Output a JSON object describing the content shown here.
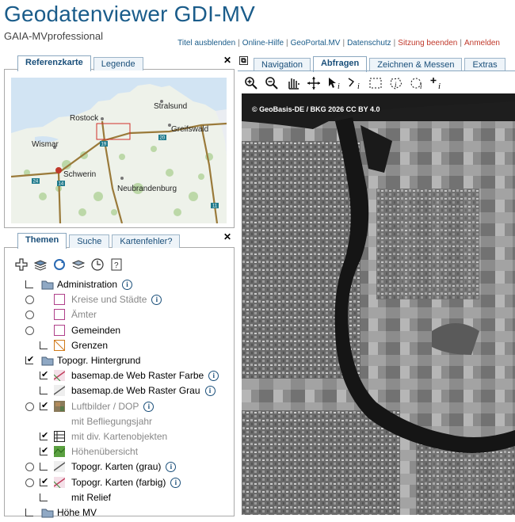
{
  "header": {
    "title": "Geodatenviewer GDI-MV",
    "subtitle": "GAIA-MVprofessional",
    "links": [
      {
        "label": "Titel ausblenden",
        "color": "#1a5c8a"
      },
      {
        "label": "Online-Hilfe",
        "color": "#1a5c8a"
      },
      {
        "label": "GeoPortal.MV",
        "color": "#1a5c8a"
      },
      {
        "label": "Datenschutz",
        "color": "#1a5c8a"
      },
      {
        "label": "Sitzung beenden",
        "color": "#c0392b"
      },
      {
        "label": "Anmelden",
        "color": "#c0392b"
      }
    ]
  },
  "ref_panel": {
    "tabs": [
      "Referenzkarte",
      "Legende"
    ],
    "active": 0,
    "places": [
      "Stralsund",
      "Rostock",
      "Greifswald",
      "Wismar",
      "Schwerin",
      "Neubrandenburg"
    ],
    "roads": [
      "19",
      "20",
      "24",
      "14",
      "11"
    ]
  },
  "layers_panel": {
    "tabs": [
      "Themen",
      "Suche",
      "Kartenfehler?"
    ],
    "active": 0,
    "layers": [
      {
        "label": "Administration",
        "control": "collapse",
        "icon": "folder",
        "info": true,
        "gray": false
      },
      {
        "label": "Kreise und Städte",
        "control": "radio",
        "icon": "swatch-purple",
        "info": true,
        "gray": true
      },
      {
        "label": "Ämter",
        "control": "radio",
        "icon": "swatch-purple",
        "info": false,
        "gray": true
      },
      {
        "label": "Gemeinden",
        "control": "radio",
        "icon": "swatch-purple",
        "info": false,
        "gray": false
      },
      {
        "label": "Grenzen",
        "control": "collapse",
        "icon": "swatch-orange",
        "info": false,
        "gray": false
      },
      {
        "label": "Topogr. Hintergrund",
        "control": "checked",
        "icon": "folder",
        "info": false,
        "gray": false
      },
      {
        "label": "basemap.de Web Raster Farbe",
        "control": "checked",
        "icon": "line-color",
        "info": true,
        "gray": false
      },
      {
        "label": "basemap.de Web Raster Grau",
        "control": "collapse",
        "icon": "line-gray",
        "info": true,
        "gray": false
      },
      {
        "label": "Luftbilder / DOP",
        "control": "radio-checked",
        "icon": "photo",
        "info": true,
        "gray": true
      },
      {
        "label": "mit Befliegungsjahr",
        "control": "none",
        "icon": "none",
        "info": false,
        "gray": true
      },
      {
        "label": "mit div. Kartenobjekten",
        "control": "checked-small",
        "icon": "table",
        "info": false,
        "gray": true
      },
      {
        "label": "Höhenübersicht",
        "control": "checked-small",
        "icon": "green",
        "info": false,
        "gray": true
      },
      {
        "label": "Topogr. Karten (grau)",
        "control": "radio-collapse",
        "icon": "line-gray",
        "info": true,
        "gray": false
      },
      {
        "label": "Topogr. Karten (farbig)",
        "control": "radio-checked",
        "icon": "line-color",
        "info": true,
        "gray": false
      },
      {
        "label": "mit Relief",
        "control": "collapse",
        "icon": "none",
        "info": false,
        "gray": false
      },
      {
        "label": "Höhe MV",
        "control": "collapse",
        "icon": "folder",
        "info": false,
        "gray": false
      }
    ]
  },
  "map_panel": {
    "tabs": [
      "Navigation",
      "Abfragen",
      "Zeichnen & Messen",
      "Extras"
    ],
    "active": 1,
    "tools": [
      "zoom-in-icon",
      "zoom-out-icon",
      "pan-hand-icon",
      "move-icon",
      "info-pointer-icon",
      "info-line-icon",
      "info-rect-icon",
      "info-polygon-icon",
      "info-circle-icon",
      "info-point-icon"
    ],
    "credit": "© GeoBasis-DE / BKG 2026 CC BY 4.0"
  }
}
